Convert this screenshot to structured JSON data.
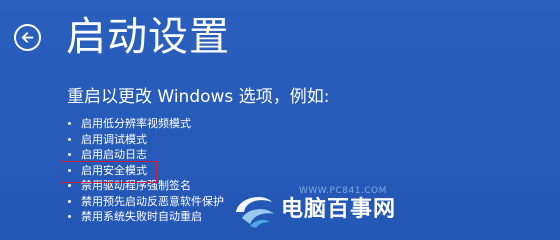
{
  "header": {
    "back_icon": "back-arrow-icon",
    "title": "启动设置"
  },
  "content": {
    "subtitle": "重启以更改 Windows 选项，例如:",
    "options": [
      "启用低分辨率视频模式",
      "启用调试模式",
      "启用启动日志",
      "启用安全模式",
      "禁用驱动程序强制签名",
      "禁用预先启动反恶意软件保护",
      "禁用系统失败时自动重启"
    ],
    "highlighted_option_index": 3
  },
  "watermark": {
    "url": "WWW.PC841.COM",
    "site_name": "电脑百事网",
    "logo_icon": "swirl-logo-icon"
  },
  "colors": {
    "background": "#2559b8",
    "text": "#ffffff",
    "highlight_border": "#c81e3c"
  }
}
